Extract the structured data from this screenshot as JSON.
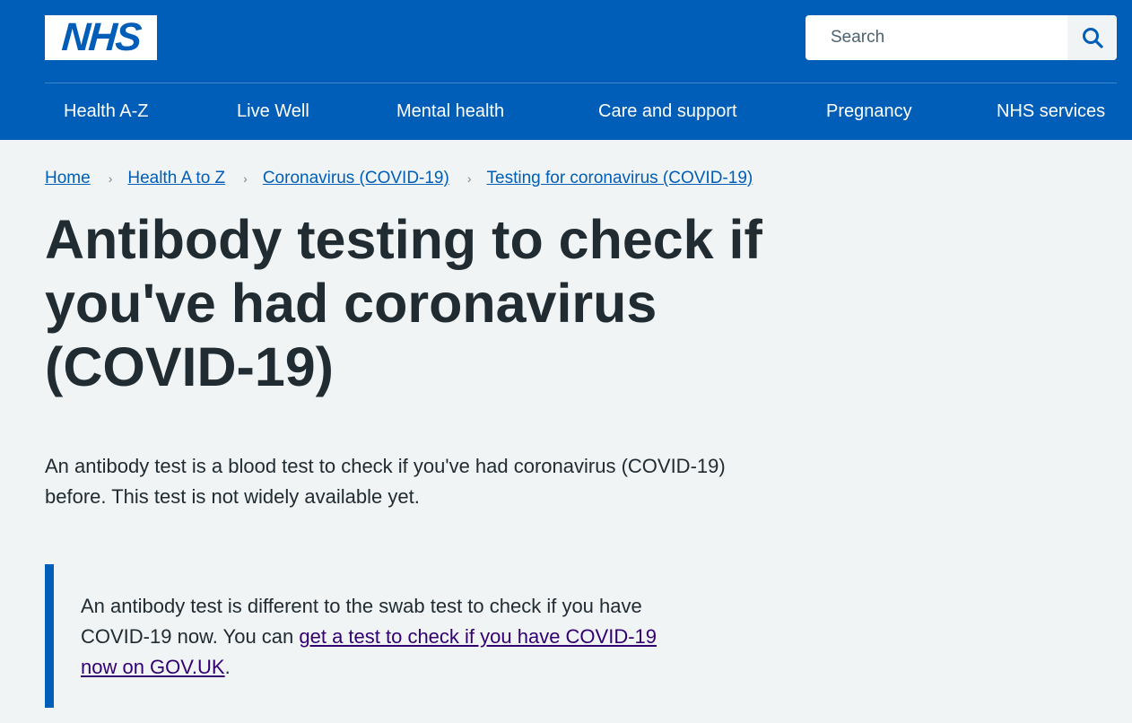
{
  "header": {
    "logo_text": "NHS",
    "search": {
      "placeholder": "Search",
      "button_icon": "search-icon"
    },
    "nav": [
      {
        "label": "Health A-Z"
      },
      {
        "label": "Live Well"
      },
      {
        "label": "Mental health"
      },
      {
        "label": "Care and support"
      },
      {
        "label": "Pregnancy"
      },
      {
        "label": "NHS services"
      }
    ]
  },
  "breadcrumb": [
    {
      "label": "Home"
    },
    {
      "label": "Health A to Z"
    },
    {
      "label": "Coronavirus (COVID-19)"
    },
    {
      "label": "Testing for coronavirus (COVID-19)"
    }
  ],
  "breadcrumb_separator_icon": "chevron-right-icon",
  "page": {
    "title": "Antibody testing to check if you've had coronavirus (COVID-19)",
    "lede": "An antibody test is a blood test to check if you've had coronavirus (COVID-19) before. This test is not widely available yet.",
    "inset": {
      "text_before": "An antibody test is different to the swab test to check if you have COVID-19 now. You can ",
      "link_text": "get a test to check if you have COVID-19 now on GOV.UK",
      "text_after": "."
    }
  },
  "colors": {
    "brand_blue": "#005eb8",
    "page_background": "#f0f4f5",
    "text": "#212b32",
    "link": "#005eb8",
    "visited_link": "#330072"
  }
}
